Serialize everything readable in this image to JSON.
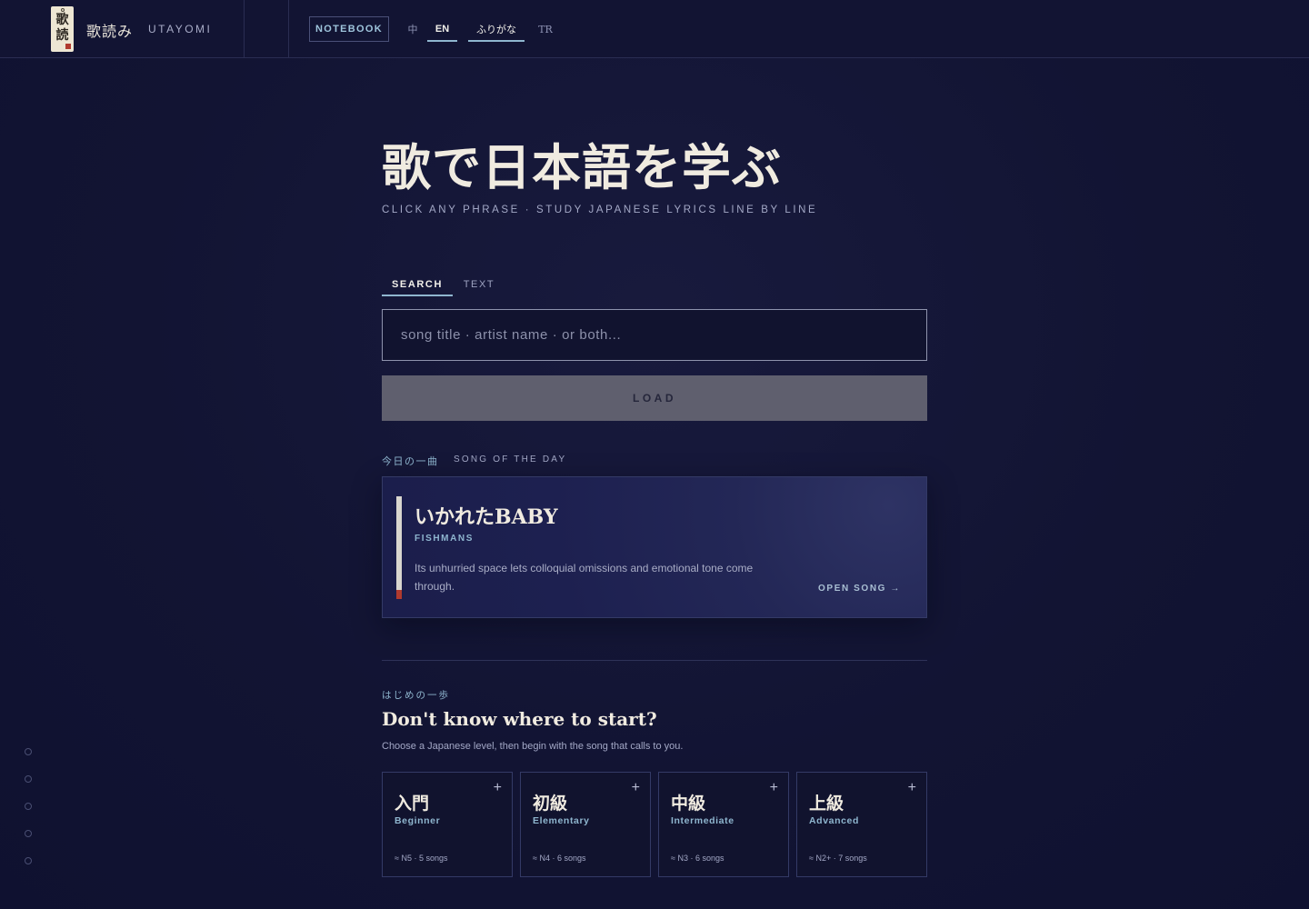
{
  "header": {
    "logo": {
      "chars": [
        "歌",
        "読"
      ]
    },
    "brand_jp": "歌読み",
    "brand_en": "UTAYOMI",
    "notebook_label": "NOTEBOOK",
    "languages": [
      {
        "label": "中",
        "active": false
      },
      {
        "label": "EN",
        "active": true
      },
      {
        "label": "ふりがな",
        "active": true
      },
      {
        "label": "TR",
        "active": false
      }
    ]
  },
  "hero": {
    "title": "歌で日本語を学ぶ",
    "subtitle": "CLICK ANY PHRASE · STUDY JAPANESE LYRICS LINE BY LINE"
  },
  "modes": {
    "tabs": [
      {
        "label": "SEARCH",
        "active": true
      },
      {
        "label": "TEXT",
        "active": false
      }
    ]
  },
  "search": {
    "value": "",
    "placeholder": "song title · artist name · or both..."
  },
  "load_label": "LOAD",
  "song_of_day": {
    "label_jp": "今日の一曲",
    "label_en": "SONG OF THE DAY",
    "title": "いかれたBABY",
    "artist": "FISHMANS",
    "description": "Its unhurried space lets colloquial omissions and emotional tone come through.",
    "open_label": "OPEN SONG →"
  },
  "start": {
    "label_jp": "はじめの一歩",
    "title": "Don't know where to start?",
    "subtitle": "Choose a Japanese level, then begin with the song that calls to you.",
    "levels": [
      {
        "jp": "入門",
        "en": "Beginner",
        "meta": "≈ N5 · 5 songs"
      },
      {
        "jp": "初級",
        "en": "Elementary",
        "meta": "≈ N4 · 6 songs"
      },
      {
        "jp": "中級",
        "en": "Intermediate",
        "meta": "≈ N3 · 6 songs"
      },
      {
        "jp": "上級",
        "en": "Advanced",
        "meta": "≈ N2+ · 7 songs"
      }
    ]
  },
  "colors": {
    "background": "#121433",
    "accent": "#8fb6cf",
    "seal_red": "#b03a2e",
    "text": "#f0ebe0"
  },
  "icons": {
    "plus": "plus-icon",
    "dot": "nav-dot-icon"
  }
}
